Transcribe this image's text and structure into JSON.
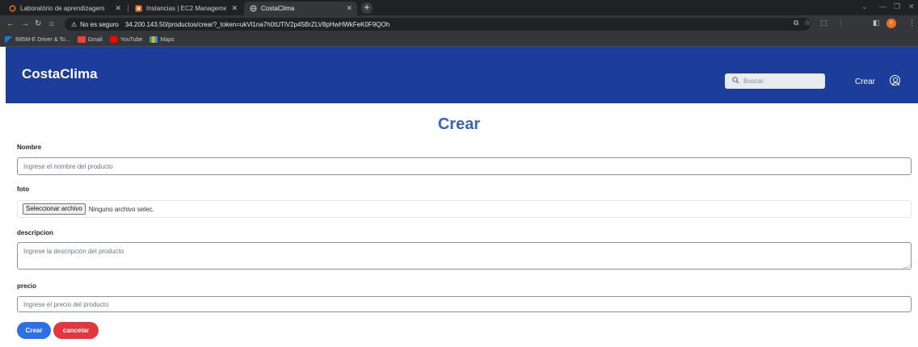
{
  "browser": {
    "tabs": [
      {
        "title": "Laboratório de aprendizagem",
        "icon": "aws-ring-icon"
      },
      {
        "title": "Instancias | EC2 Management C",
        "icon": "ec2-icon"
      },
      {
        "title": "CostaClima",
        "icon": "globe-icon"
      }
    ],
    "new_tab_label": "+",
    "security_label": "No es seguro",
    "url": "34.200.143.50/productos/crear?_token=ukVl1na7h0tUTlV2p45BrZLV8pHwHWkFeK0F9QOh",
    "profile_initial": "c",
    "bookmarks": [
      {
        "label": "B85M-E Driver & To...",
        "icon": "asus-icon"
      },
      {
        "label": "Gmail",
        "icon": "gmail-icon"
      },
      {
        "label": "YouTube",
        "icon": "youtube-icon"
      },
      {
        "label": "Maps",
        "icon": "maps-icon"
      }
    ]
  },
  "navbar": {
    "brand": "CostaClima",
    "search_placeholder": "Buscar",
    "crear_link": "Crear"
  },
  "form": {
    "title": "Crear",
    "nombre": {
      "label": "Nombre",
      "placeholder": "Ingrese el nombre del producto",
      "value": ""
    },
    "foto": {
      "label": "foto",
      "button": "Seleccionar archivo",
      "status": "Ninguno archivo selec."
    },
    "descripcion": {
      "label": "descripcion",
      "placeholder": "Ingrese la descripción del producto",
      "value": ""
    },
    "precio": {
      "label": "precio",
      "placeholder": "Ingrese el precio del producto",
      "value": ""
    },
    "submit_label": "Crear",
    "cancel_label": "cancelar"
  },
  "colors": {
    "navbar_bg": "#1d3d9a",
    "title": "#3a63b8",
    "primary": "#2f6fe6",
    "danger": "#e4363f"
  }
}
